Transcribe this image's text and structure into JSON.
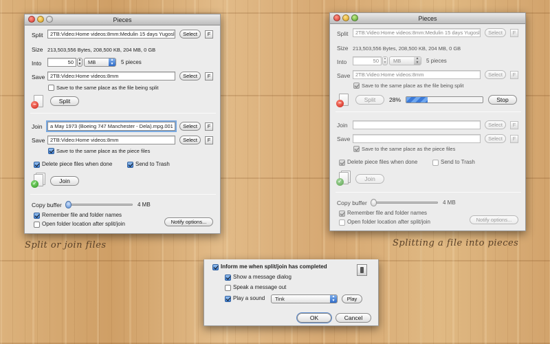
{
  "captions": {
    "left": "Split or join files",
    "right": "Splitting a file into pieces"
  },
  "left_window": {
    "title": "Pieces",
    "split_label": "Split",
    "split_path": "2TB:Video:Home videos:8mm:Medulin 15 days Yugosl",
    "select_label": "Select",
    "f_label": "F",
    "size_label": "Size",
    "size_value": "213,503,556 Bytes, 208,500 KB, 204 MB, 0 GB",
    "into_label": "Into",
    "into_value": "50",
    "unit_value": "MB",
    "pieces_text": "5 pieces",
    "save_label": "Save",
    "save_path": "2TB:Video:Home videos:8mm",
    "save_same_place": "Save to the same place as the file being split",
    "split_button": "Split",
    "join_label": "Join",
    "join_path": "a May 1973  (Boeing 747 Manchester - Dela).mpg.001",
    "join_save_label": "Save",
    "join_save_path": "2TB:Video:Home videos:8mm",
    "join_same_place": "Save to the same place as the piece files",
    "delete_pieces": "Delete piece files when done",
    "send_trash": "Send to Trash",
    "join_button": "Join",
    "copy_buffer_label": "Copy buffer",
    "copy_buffer_value": "4 MB",
    "remember_names": "Remember file and folder names",
    "open_folder": "Open folder location after split/join",
    "notify_button": "Notify options..."
  },
  "right_window": {
    "title": "Pieces",
    "split_label": "Split",
    "split_path": "2TB:Video:Home videos:8mm:Medulin 15 days Yugosl",
    "select_label": "Select",
    "f_label": "F",
    "size_label": "Size",
    "size_value": "213,503,556 Bytes, 208,500 KB, 204 MB, 0 GB",
    "into_label": "Into",
    "into_value": "50",
    "unit_value": "MB",
    "pieces_text": "5 pieces",
    "save_label": "Save",
    "save_path": "2TB:Video:Home videos:8mm",
    "save_same_place": "Save to the same place as the file being split",
    "split_button": "Split",
    "progress_text": "28%",
    "progress_fraction": 0.28,
    "stop_button": "Stop",
    "join_label": "Join",
    "join_path": "",
    "join_save_label": "Save",
    "join_save_path": "",
    "join_same_place": "Save to the same place as the piece files",
    "delete_pieces": "Delete piece files when done",
    "send_trash": "Send to Trash",
    "join_button": "Join",
    "copy_buffer_label": "Copy buffer",
    "copy_buffer_value": "4 MB",
    "remember_names": "Remember file and folder names",
    "open_folder": "Open folder location after split/join",
    "notify_button": "Notify options..."
  },
  "notify_dialog": {
    "inform": "Inform me when split/join has completed",
    "show_dialog": "Show a message dialog",
    "speak": "Speak a message out",
    "play_sound": "Play a sound",
    "sound_value": "Tink",
    "play_button": "Play",
    "ok_button": "OK",
    "cancel_button": "Cancel"
  }
}
